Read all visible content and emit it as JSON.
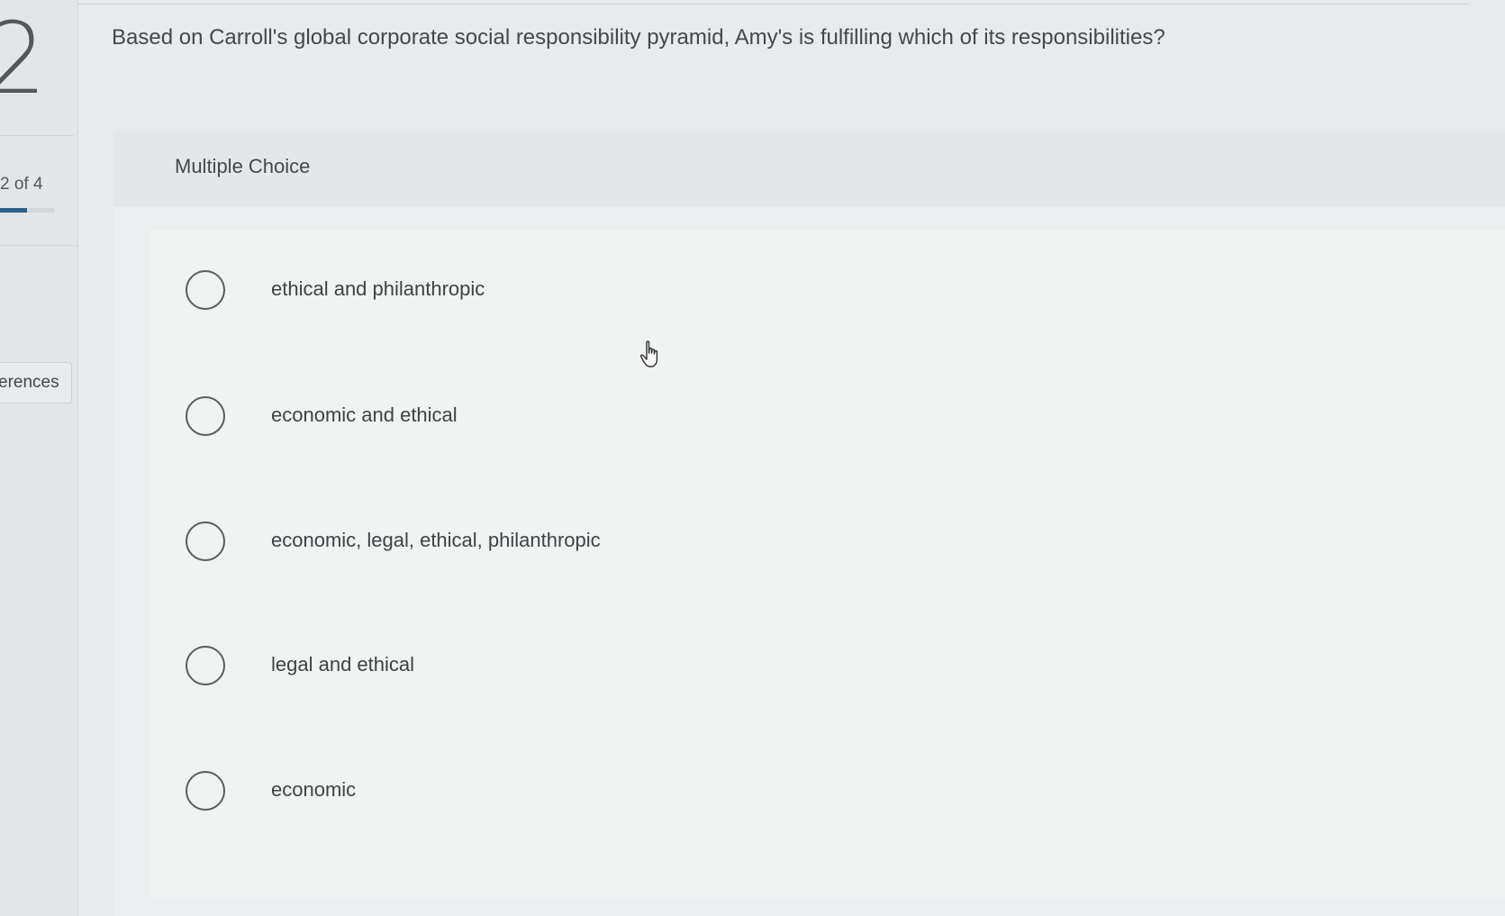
{
  "sidebar": {
    "question_number": "2",
    "progress_text": "2 of 4",
    "progress_fraction": 0.5,
    "references_label": "erences"
  },
  "question": {
    "text": "Based on Carroll's global corporate social responsibility pyramid, Amy's is fulfilling which of its responsibilities?"
  },
  "panel": {
    "title": "Multiple Choice",
    "choices": [
      {
        "label": "ethical and philanthropic"
      },
      {
        "label": "economic and ethical"
      },
      {
        "label": "economic, legal, ethical, philanthropic"
      },
      {
        "label": "legal and ethical"
      },
      {
        "label": "economic"
      }
    ]
  },
  "icons": {
    "cursor": "hand-pointer-icon"
  }
}
